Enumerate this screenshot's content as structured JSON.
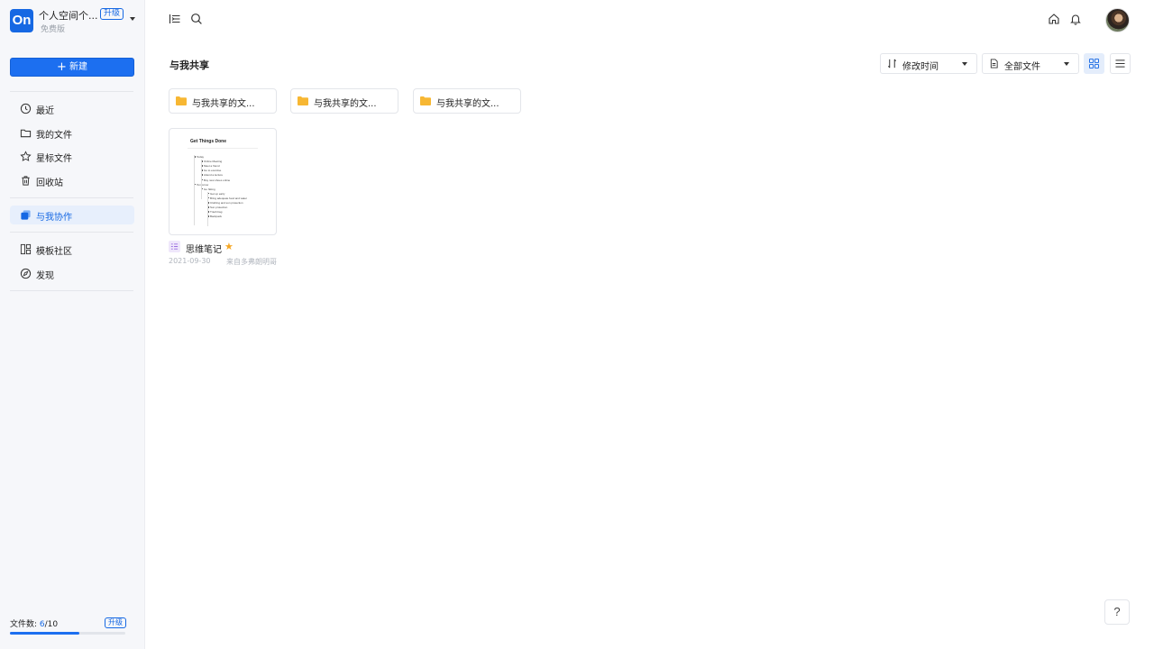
{
  "workspace": {
    "logo_text": "On",
    "name": "个人空间个...",
    "plan": "免费版",
    "upgrade_label": "升级"
  },
  "sidebar": {
    "new_button_label": "新建",
    "items": [
      {
        "label": "最近",
        "icon": "clock-icon"
      },
      {
        "label": "我的文件",
        "icon": "folder-icon"
      },
      {
        "label": "星标文件",
        "icon": "star-icon"
      },
      {
        "label": "回收站",
        "icon": "trash-icon"
      },
      {
        "label": "与我协作",
        "icon": "collaboration-icon",
        "active": true
      },
      {
        "label": "模板社区",
        "icon": "template-icon"
      },
      {
        "label": "发现",
        "icon": "compass-icon"
      }
    ],
    "quota": {
      "label": "文件数: ",
      "used": "6",
      "total": "/10",
      "fraction": 0.6,
      "upgrade_label": "升级"
    }
  },
  "topbar": {
    "left_icons": [
      "expand-sidebar-icon",
      "search-icon"
    ],
    "right_icons": [
      "home-icon",
      "bell-icon",
      "avatar"
    ]
  },
  "main": {
    "title": "与我共享",
    "sort_label": "修改时间",
    "filter_label": "全部文件",
    "view_modes": [
      "grid-view",
      "list-view"
    ],
    "active_view": "grid-view",
    "folders": [
      {
        "label": "与我共享的文..."
      },
      {
        "label": "与我共享的文..."
      },
      {
        "label": "与我共享的文..."
      }
    ],
    "files": [
      {
        "name": "思维笔记",
        "starred": true,
        "date": "2021-09-30",
        "from": "来自多弗朗明哥",
        "thumbnail": {
          "title": "Get Things Done",
          "items": [
            {
              "text": "Today",
              "level": 1
            },
            {
              "text": "Online Meeting",
              "level": 2
            },
            {
              "text": "Meet a friend",
              "level": 2
            },
            {
              "text": "Go to exercise",
              "level": 2
            },
            {
              "text": "Attend a lecture",
              "level": 2
            },
            {
              "text": "Buy new shoes online",
              "level": 2
            },
            {
              "text": "Tomorrow",
              "level": 1
            },
            {
              "text": "Go hiking",
              "level": 2
            },
            {
              "text": "Get up early",
              "level": 3
            },
            {
              "text": "Bring adequate food and water",
              "level": 3
            },
            {
              "text": "Clothing and sun protection",
              "level": 3
            },
            {
              "text": "Sun protection",
              "level": 3
            },
            {
              "text": "Trash bag",
              "level": 3
            },
            {
              "text": "Backpack",
              "level": 3
            }
          ]
        }
      }
    ]
  },
  "help_label": "?",
  "colors": {
    "accent": "#1668e3",
    "folder": "#f7b733",
    "star": "#f5a623"
  }
}
